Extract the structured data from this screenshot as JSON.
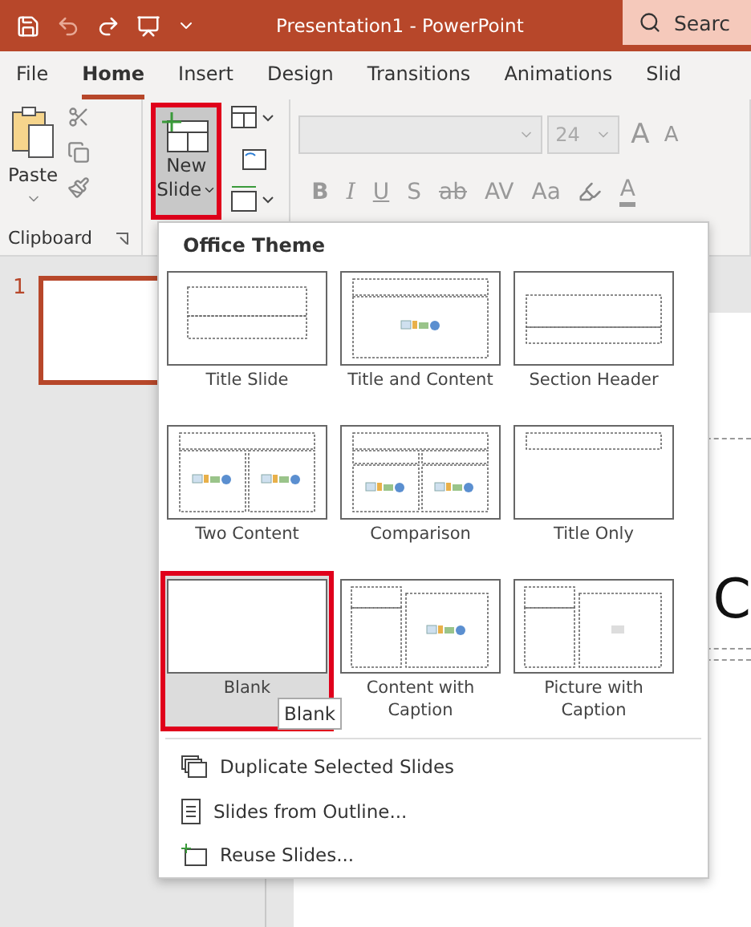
{
  "window": {
    "title": "Presentation1  -  PowerPoint"
  },
  "search": {
    "placeholder": "Searc"
  },
  "tabs": [
    {
      "label": "File",
      "selected": false
    },
    {
      "label": "Home",
      "selected": true
    },
    {
      "label": "Insert",
      "selected": false
    },
    {
      "label": "Design",
      "selected": false
    },
    {
      "label": "Transitions",
      "selected": false
    },
    {
      "label": "Animations",
      "selected": false
    },
    {
      "label": "Slid",
      "selected": false
    }
  ],
  "clipboard": {
    "paste_label": "Paste",
    "group_label": "Clipboard"
  },
  "slides_group": {
    "new_slide_label": [
      "New",
      "Slide"
    ]
  },
  "font_group": {
    "font_size": "24",
    "grow_font": "A",
    "shrink_font": "A",
    "format_buttons": [
      {
        "label": "B",
        "kind": "bold"
      },
      {
        "label": "I",
        "kind": "italic"
      },
      {
        "label": "U",
        "kind": "underline"
      },
      {
        "label": "S",
        "kind": "shadow"
      },
      {
        "label": "ab",
        "kind": "strike"
      },
      {
        "label": "AV",
        "kind": "spacing"
      },
      {
        "label": "Aa",
        "kind": "case"
      }
    ],
    "font_color": "A"
  },
  "slide_pane": {
    "slides": [
      {
        "number": "1",
        "selected": true
      }
    ]
  },
  "slide": {
    "title_fragment": "C"
  },
  "new_slide_menu": {
    "heading": "Office Theme",
    "layouts": [
      {
        "label": "Title Slide",
        "kind": "title",
        "selected": false
      },
      {
        "label": "Title and Content",
        "kind": "title-content",
        "selected": false
      },
      {
        "label": "Section Header",
        "kind": "section",
        "selected": false
      },
      {
        "label": "Two Content",
        "kind": "two-content",
        "selected": false
      },
      {
        "label": "Comparison",
        "kind": "comparison",
        "selected": false
      },
      {
        "label": "Title Only",
        "kind": "title-only",
        "selected": false
      },
      {
        "label": "Blank",
        "kind": "blank",
        "selected": true
      },
      {
        "label": "Content with Caption",
        "kind": "content-caption",
        "selected": false
      },
      {
        "label": "Picture with Caption",
        "kind": "picture-caption",
        "selected": false
      }
    ],
    "tooltip": "Blank",
    "commands": [
      {
        "label": "Duplicate Selected Slides",
        "kind": "duplicate"
      },
      {
        "label": "Slides from Outline...",
        "kind": "outline"
      },
      {
        "label": "Reuse Slides...",
        "kind": "reuse"
      }
    ]
  }
}
